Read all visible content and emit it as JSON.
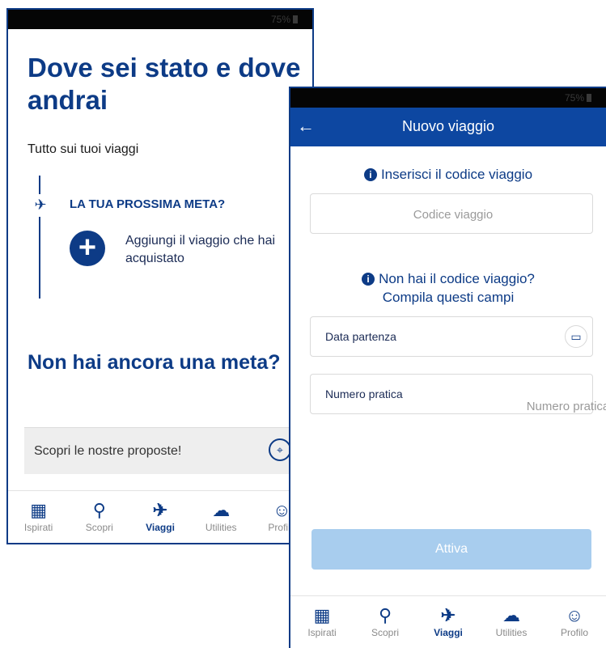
{
  "screen1": {
    "status_battery": "75%",
    "title": "Dove sei stato e dove andrai",
    "subtitle": "Tutto sui tuoi viaggi",
    "next_destination_label": "LA TUA PROSSIMA META?",
    "add_trip_text": "Aggiungi il viaggio che hai acquistato",
    "no_destination_title": "Non hai ancora una meta?",
    "offers_label": "Scopri le nostre proposte!"
  },
  "screen2": {
    "status_battery": "75%",
    "nav_title": "Nuovo viaggio",
    "code_info": "Inserisci il codice viaggio",
    "code_placeholder": "Codice viaggio",
    "no_code_info_line1": "Non hai il codice viaggio?",
    "no_code_info_line2": "Compila questi campi",
    "departure_label": "Data partenza",
    "practice_label": "Numero pratica",
    "practice_placeholder": "Numero pratica",
    "activate_label": "Attiva"
  },
  "tabs": [
    {
      "label": "Ispirati",
      "icon": "layout-icon"
    },
    {
      "label": "Scopri",
      "icon": "search-icon"
    },
    {
      "label": "Viaggi",
      "icon": "plane-icon"
    },
    {
      "label": "Utilities",
      "icon": "translate-icon"
    },
    {
      "label": "Profilo",
      "icon": "user-icon"
    }
  ],
  "colors": {
    "primary": "#0d3b86",
    "navbar": "#0d47a1",
    "button_disabled": "#a8cdee"
  }
}
